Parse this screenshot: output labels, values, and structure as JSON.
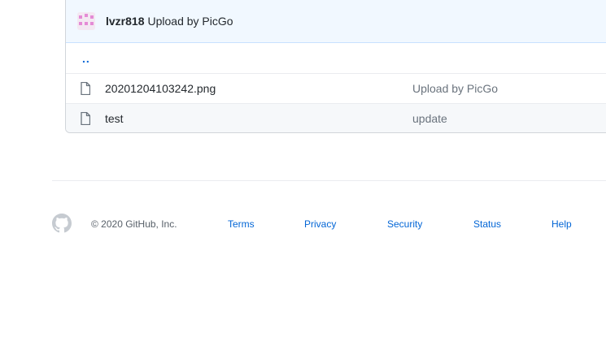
{
  "commit": {
    "author": "lvzr818",
    "message": "Upload by PicGo"
  },
  "files": {
    "parent_link": "..",
    "items": [
      {
        "name": "20201204103242.png",
        "message": "Upload by PicGo",
        "icon": "file-icon"
      },
      {
        "name": "test",
        "message": "update",
        "icon": "file-icon"
      }
    ]
  },
  "footer": {
    "copyright": "© 2020 GitHub, Inc.",
    "links": [
      "Terms",
      "Privacy",
      "Security",
      "Status",
      "Help"
    ]
  },
  "colors": {
    "link": "#0366d6",
    "commit_bar_bg": "#f1f8ff",
    "avatar_accent": "#e48bd6"
  }
}
